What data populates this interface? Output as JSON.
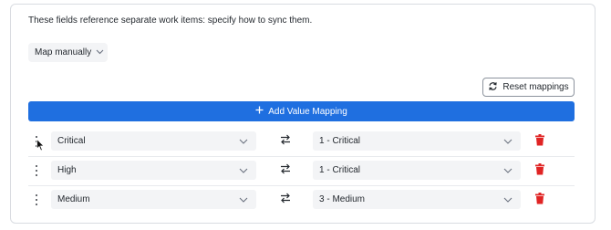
{
  "instructions": "These fields reference separate work items: specify how to sync them.",
  "mapping_mode": {
    "selected": "Map manually",
    "icon": "chevron-down-icon"
  },
  "reset_button": {
    "label": "Reset mappings",
    "icon": "refresh-icon"
  },
  "add_button": {
    "label": "Add Value Mapping",
    "icon": "plus-icon"
  },
  "mappings": [
    {
      "source": "Critical",
      "target": "1 - Critical"
    },
    {
      "source": "High",
      "target": "1 - Critical"
    },
    {
      "source": "Medium",
      "target": "3 - Medium"
    }
  ],
  "icons": {
    "handle": "drag-handle-icon",
    "swap": "swap-arrows-icon",
    "delete": "trash-icon"
  },
  "colors": {
    "primary": "#1f6fe0",
    "danger": "#e02424",
    "field_bg": "#f3f4f6",
    "border": "#d9dce1"
  }
}
